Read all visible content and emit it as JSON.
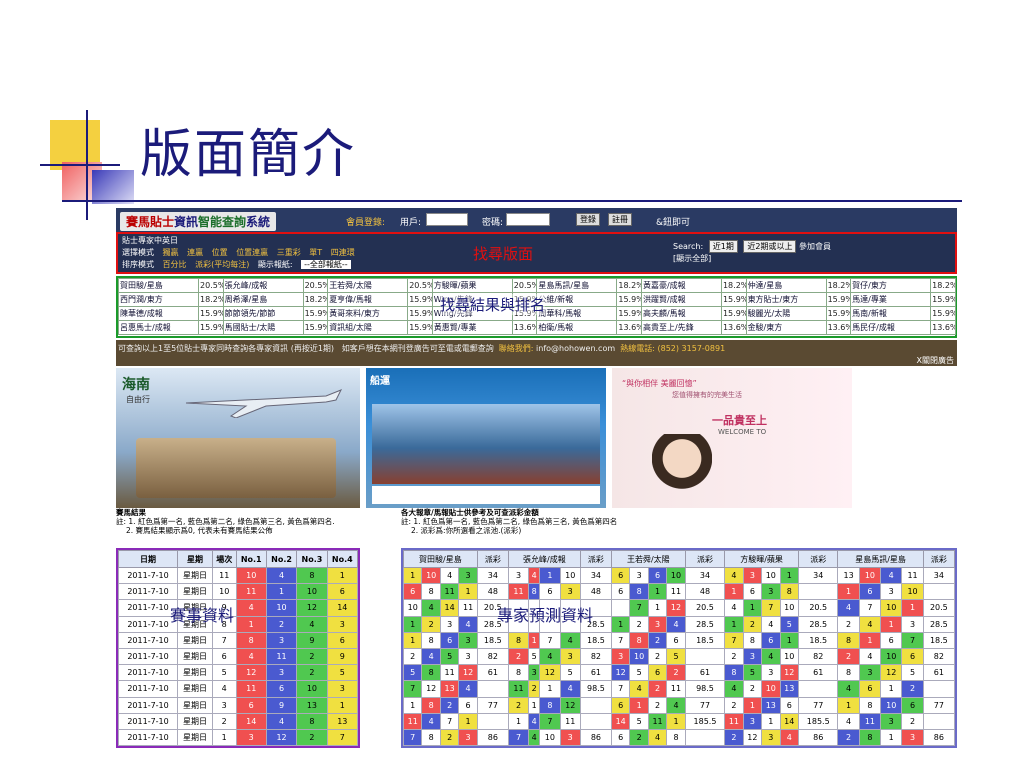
{
  "slide": {
    "title": "版面簡介",
    "accent": "#1b1b7a"
  },
  "topbar": {
    "logo_a": "賽馬貼士",
    "logo_b": "資訊",
    "logo_c": "智能查詢",
    "logo_d": "系統",
    "member_login": "會員登錄:",
    "user_label": "用戶:",
    "password_label": "密碼:",
    "login_button": "登錄",
    "register_button": "註冊",
    "forgot": "&鈕即可"
  },
  "search": {
    "row1": [
      "貼士專家中英日"
    ],
    "row2": [
      "選擇模式",
      "獨贏",
      "連贏",
      "位置",
      "位置連贏",
      "三重彩",
      "單T",
      "四連環"
    ],
    "row3": [
      "排序模式",
      "百分比",
      "派彩(平均每注)",
      "顯示報紙:",
      "--全部報紙--"
    ],
    "title": "找尋版面",
    "right_label": "Search:",
    "btn_recent": "近1期",
    "btn_recent2": "近2期或以上",
    "right_tail": "參加會員",
    "show_all": "[顯示全部]"
  },
  "grid": {
    "title": "找尋結果與排名",
    "rows": [
      [
        "賀田駿/星島",
        "20.5%",
        "張允峰/成報",
        "20.5%",
        "王若舜/太陽",
        "20.5%",
        "方駿暉/蘋果",
        "20.5%",
        "星島馬訊/星島",
        "18.2%",
        "黃嘉豪/成報",
        "18.2%",
        "仲達/星島",
        "18.2%",
        "賀仔/東方",
        "18.2%"
      ],
      [
        "西門潤/東方",
        "18.2%",
        "周希澤/星島",
        "18.2%",
        "夏亨偉/馬報",
        "15.9%",
        "Wing/先鋒",
        "15.9%",
        "公維/新報",
        "15.9%",
        "洪躍賢/成報",
        "15.9%",
        "東方貼士/東方",
        "15.9%",
        "馬達/專業",
        "15.9%"
      ],
      [
        "陳華德/成報",
        "15.9%",
        "節節領先/節節",
        "15.9%",
        "黃哥來料/東方",
        "15.9%",
        "Wing/先鋒",
        "15.9%",
        "周華科/馬報",
        "15.9%",
        "高夫麟/馬報",
        "15.9%",
        "駿麗光/太陽",
        "15.9%",
        "馬南/新報",
        "15.9%"
      ],
      [
        "呂惠馬士/成報",
        "15.9%",
        "馬國貼士/太陽",
        "15.9%",
        "資訊組/太陽",
        "15.9%",
        "黃惠賢/專業",
        "13.6%",
        "柏衛/馬報",
        "13.6%",
        "高貴至上/先鋒",
        "13.6%",
        "金駿/東方",
        "13.6%",
        "馬民仔/成報",
        "13.6%"
      ]
    ]
  },
  "info": {
    "text_a": "可查詢以上1至5位貼士專家同時查詢各專家資訊 (再按近1期)",
    "text_b": "如客戶想在本網刊登廣告可至電或電郵查詢",
    "contact_label": "聯絡我們:",
    "email": "info@hohowen.com",
    "phone_label": "熱線電話:",
    "phone": "(852) 3157-0891",
    "close": "X關閉廣告"
  },
  "ads": {
    "ad1_title": "海南",
    "ad1_sub": "自由行",
    "ad2_title": "船運",
    "ad3_line1": "“與你相伴 美麗回憶”",
    "ad3_line2": "您值得擁有的完美生活",
    "ad3_badge": "一品貴至上",
    "ad3_sub": "WELCOME TO"
  },
  "race": {
    "heading": "賽馬結果",
    "note1": "註: 1. 紅色爲第一名, 藍色爲第二名, 綠色爲第三名, 黃色爲第四名.",
    "note2": "2. 賽馬結果顯示爲0, 代表未有賽馬結果公佈",
    "label": "賽事資料",
    "headers": [
      "日期",
      "星期",
      "場次",
      "No.1",
      "No.2",
      "No.3",
      "No.4"
    ],
    "rows": [
      [
        "2011-7-10",
        "星期日",
        "11",
        "10",
        "4",
        "8",
        "1"
      ],
      [
        "2011-7-10",
        "星期日",
        "10",
        "11",
        "1",
        "10",
        "6"
      ],
      [
        "2011-7-10",
        "星期日",
        "9",
        "4",
        "10",
        "12",
        "14"
      ],
      [
        "2011-7-10",
        "星期日",
        "8",
        "1",
        "2",
        "4",
        "3"
      ],
      [
        "2011-7-10",
        "星期日",
        "7",
        "8",
        "3",
        "9",
        "6"
      ],
      [
        "2011-7-10",
        "星期日",
        "6",
        "4",
        "11",
        "2",
        "9"
      ],
      [
        "2011-7-10",
        "星期日",
        "5",
        "12",
        "3",
        "2",
        "5"
      ],
      [
        "2011-7-10",
        "星期日",
        "4",
        "11",
        "6",
        "10",
        "3"
      ],
      [
        "2011-7-10",
        "星期日",
        "3",
        "6",
        "9",
        "13",
        "1"
      ],
      [
        "2011-7-10",
        "星期日",
        "2",
        "14",
        "4",
        "8",
        "13"
      ],
      [
        "2011-7-10",
        "星期日",
        "1",
        "3",
        "12",
        "2",
        "7"
      ]
    ]
  },
  "experts": {
    "heading": "各大報章/馬報貼士供參考及可查派彩金額",
    "note1": "註: 1. 紅色爲第一名, 藍色爲第二名, 綠色爲第三名, 黃色爲第四名",
    "note2": "2. 派彩爲:你所選看之派池.(派彩)",
    "label": "專家預測資料",
    "groups": [
      "賀田駿/星島",
      "張允峰/成報",
      "王若舜/太陽",
      "方駿暉/蘋果",
      "星島馬訊/星島"
    ],
    "payout": "派彩",
    "rows": [
      [
        "1",
        "10",
        "4",
        "3",
        "34",
        "3",
        "4",
        "1",
        "10",
        "34",
        "6",
        "3",
        "6",
        "10",
        "34",
        "4",
        "3",
        "10",
        "1",
        "34",
        "13",
        "10",
        "4",
        "11",
        "34"
      ],
      [
        "6",
        "8",
        "11",
        "1",
        "48",
        "11",
        "8",
        "6",
        "3",
        "48",
        "6",
        "8",
        "1",
        "11",
        "48",
        "1",
        "6",
        "3",
        "8",
        "",
        "1",
        "6",
        "3",
        "10",
        ""
      ],
      [
        "10",
        "4",
        "14",
        "11",
        "20.5",
        "",
        "",
        "",
        "",
        "",
        "",
        "7",
        "1",
        "12",
        "20.5",
        "4",
        "1",
        "7",
        "10",
        "20.5",
        "4",
        "7",
        "10",
        "1",
        "20.5"
      ],
      [
        "1",
        "2",
        "3",
        "4",
        "28.5",
        "",
        "",
        "",
        "",
        "28.5",
        "1",
        "2",
        "3",
        "4",
        "28.5",
        "1",
        "2",
        "4",
        "5",
        "28.5",
        "2",
        "4",
        "1",
        "3",
        "28.5"
      ],
      [
        "1",
        "8",
        "6",
        "3",
        "18.5",
        "8",
        "1",
        "7",
        "4",
        "18.5",
        "7",
        "8",
        "2",
        "6",
        "18.5",
        "7",
        "8",
        "6",
        "1",
        "18.5",
        "8",
        "1",
        "6",
        "7",
        "18.5"
      ],
      [
        "2",
        "4",
        "5",
        "3",
        "82",
        "2",
        "5",
        "4",
        "3",
        "82",
        "3",
        "10",
        "2",
        "5",
        "",
        "2",
        "3",
        "4",
        "10",
        "82",
        "2",
        "4",
        "10",
        "6",
        "82"
      ],
      [
        "5",
        "8",
        "11",
        "12",
        "61",
        "8",
        "3",
        "12",
        "5",
        "61",
        "12",
        "5",
        "6",
        "2",
        "61",
        "8",
        "5",
        "3",
        "12",
        "61",
        "8",
        "3",
        "12",
        "5",
        "61"
      ],
      [
        "7",
        "12",
        "13",
        "4",
        "",
        "11",
        "2",
        "1",
        "4",
        "98.5",
        "7",
        "4",
        "2",
        "11",
        "98.5",
        "4",
        "2",
        "10",
        "13",
        "",
        "4",
        "6",
        "1",
        "2",
        ""
      ],
      [
        "1",
        "8",
        "2",
        "6",
        "77",
        "2",
        "1",
        "8",
        "12",
        "",
        "6",
        "1",
        "2",
        "4",
        "77",
        "2",
        "1",
        "13",
        "6",
        "77",
        "1",
        "8",
        "10",
        "6",
        "77"
      ],
      [
        "11",
        "4",
        "7",
        "1",
        "",
        "1",
        "4",
        "7",
        "11",
        "",
        "14",
        "5",
        "11",
        "1",
        "185.5",
        "11",
        "3",
        "1",
        "14",
        "185.5",
        "4",
        "11",
        "3",
        "2",
        ""
      ],
      [
        "7",
        "8",
        "2",
        "3",
        "86",
        "7",
        "4",
        "10",
        "3",
        "86",
        "6",
        "2",
        "4",
        "8",
        "",
        "2",
        "12",
        "3",
        "4",
        "86",
        "2",
        "8",
        "1",
        "3",
        "86"
      ]
    ]
  }
}
